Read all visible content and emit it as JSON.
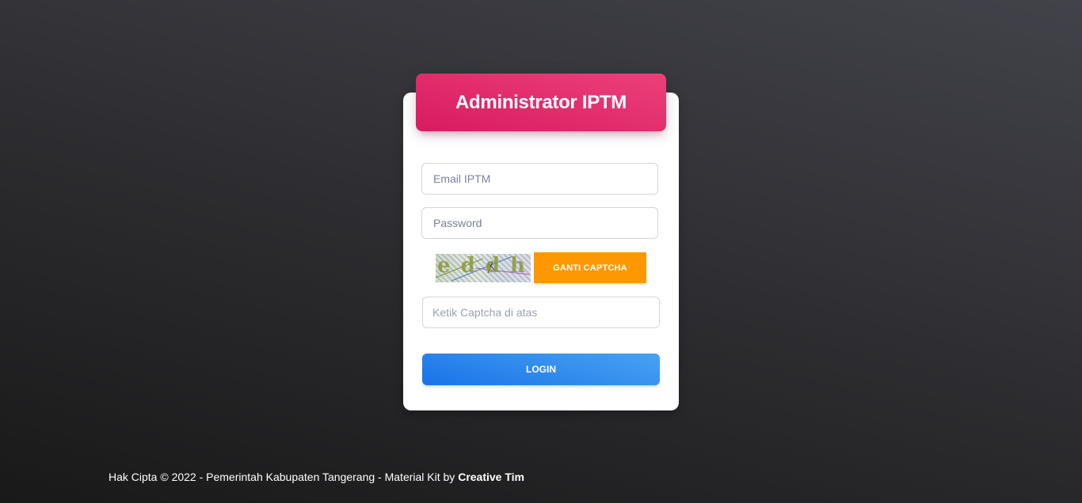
{
  "login_card": {
    "title": "Administrator IPTM",
    "email_placeholder": "Email IPTM",
    "password_placeholder": "Password",
    "captcha_text": "e d d h",
    "captcha_button_label": "GANTI CAPTCHA",
    "captcha_placeholder": "Ketik Captcha di atas",
    "login_button_label": "LOGIN"
  },
  "footer": {
    "copyright_text": "Hak Cipta © 2022 - Pemerintah Kabupaten Tangerang - Material Kit by ",
    "author_link": "Creative Tim"
  },
  "colors": {
    "header_gradient": [
      "#ec407a",
      "#d81b60"
    ],
    "captcha_button": "#ff9800",
    "login_button_gradient": [
      "#49a3f1",
      "#1a73e8"
    ],
    "background_gradient": [
      "#42424a",
      "#191919"
    ]
  }
}
